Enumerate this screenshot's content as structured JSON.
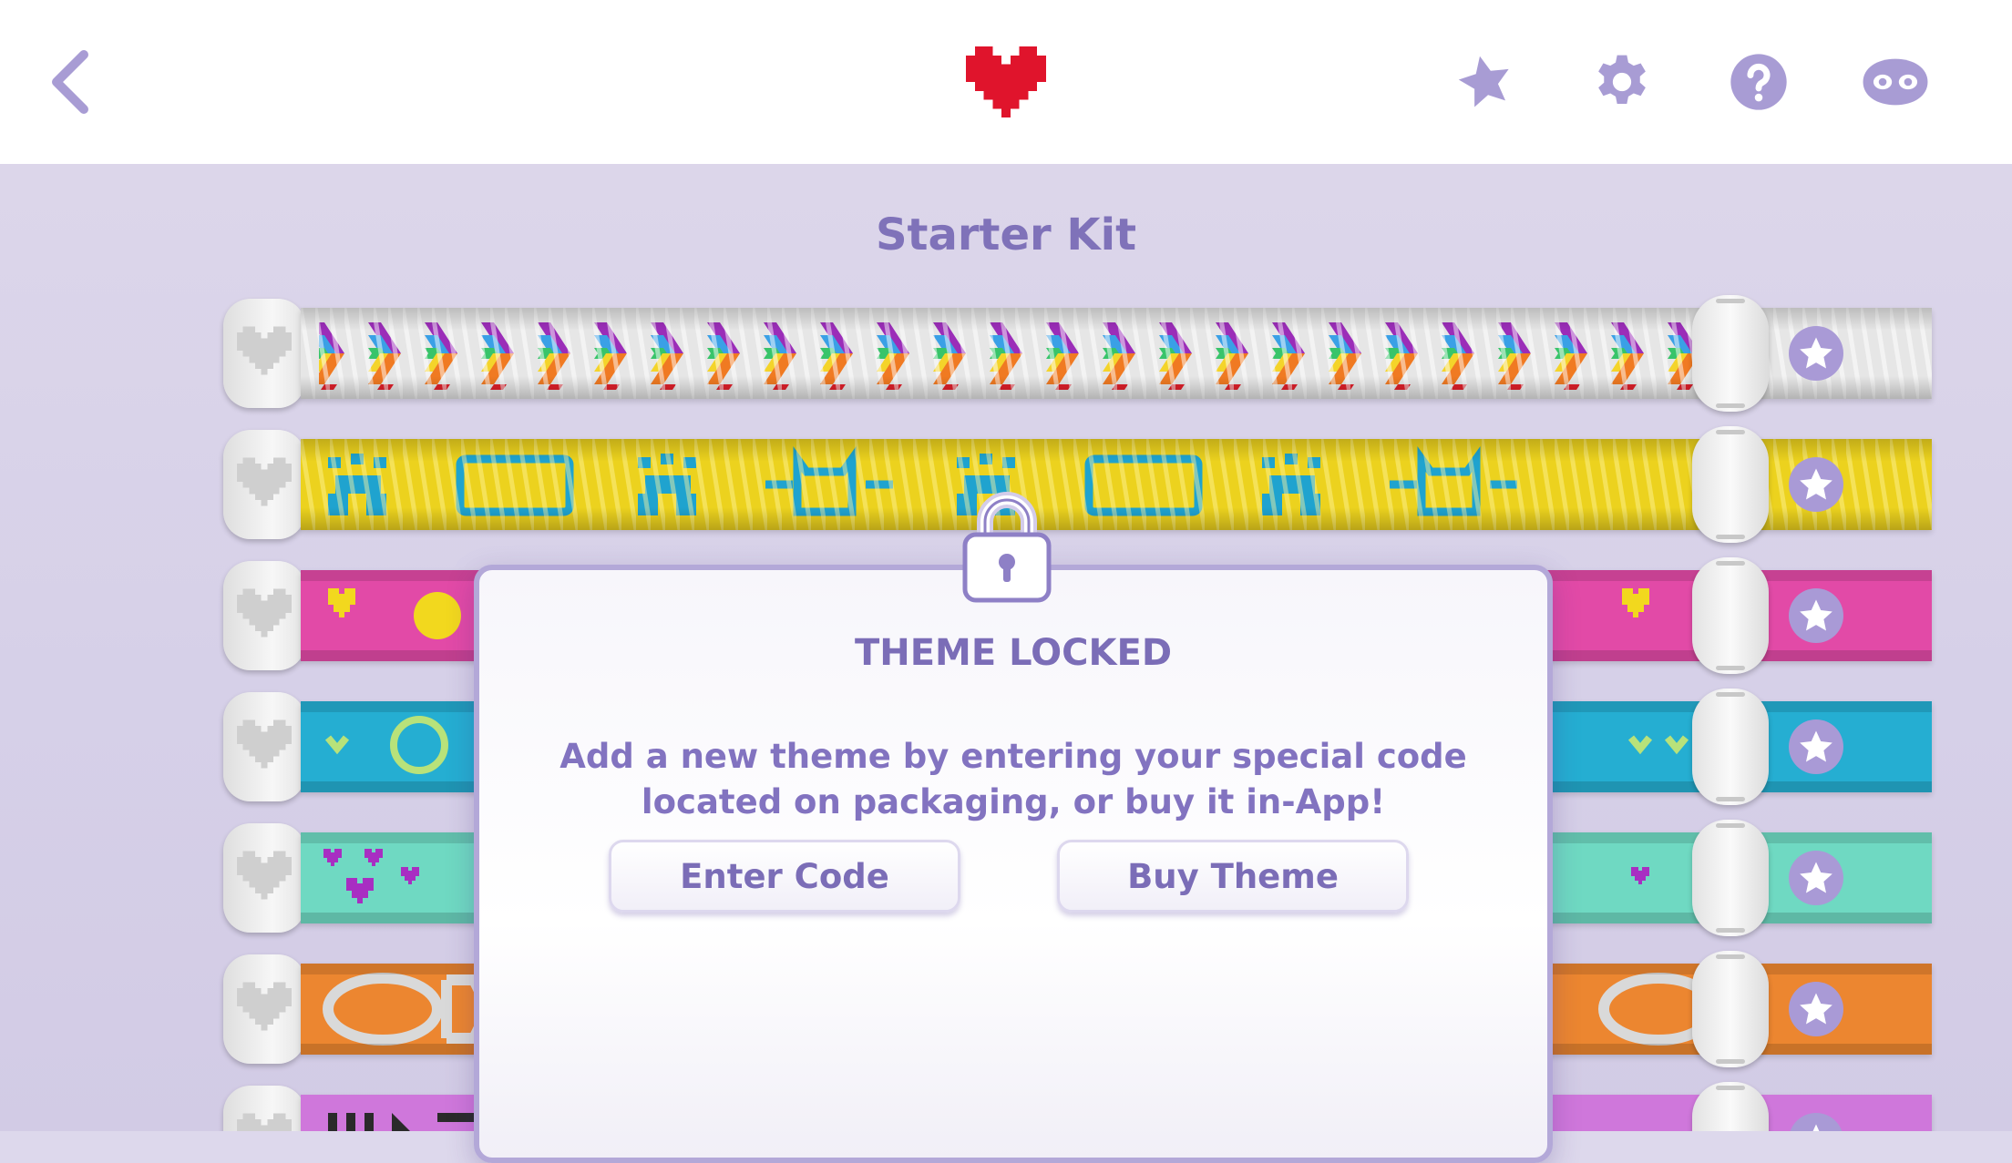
{
  "header": {
    "back_icon": "chevron-left-icon",
    "logo_icon": "pixel-heart-icon",
    "actions": [
      {
        "icon": "star-icon"
      },
      {
        "icon": "gear-icon"
      },
      {
        "icon": "help-icon"
      },
      {
        "icon": "mask-icon"
      }
    ]
  },
  "section": {
    "title": "Starter Kit"
  },
  "bracelets": [
    {
      "theme": "rainbow-chevrons",
      "color": "#e9e9e9"
    },
    {
      "theme": "paws-dogs-cats",
      "color": "#ecd21e"
    },
    {
      "theme": "hearts",
      "color": "#e24aa7"
    },
    {
      "theme": "smileys",
      "color": "#25aed2"
    },
    {
      "theme": "purple-hearts",
      "color": "#6fd9c2"
    },
    {
      "theme": "dream-team",
      "color": "#ec8630"
    },
    {
      "theme": "black-pattern",
      "color": "#cf77db"
    }
  ],
  "modal": {
    "title": "THEME LOCKED",
    "message": "Add a new theme by entering your special code located on packaging, or buy it in-App!",
    "enter_code_label": "Enter Code",
    "buy_theme_label": "Buy Theme"
  },
  "colors": {
    "accent": "#7f72b9",
    "heart": "#e0142c",
    "icon": "#a89cd4"
  }
}
